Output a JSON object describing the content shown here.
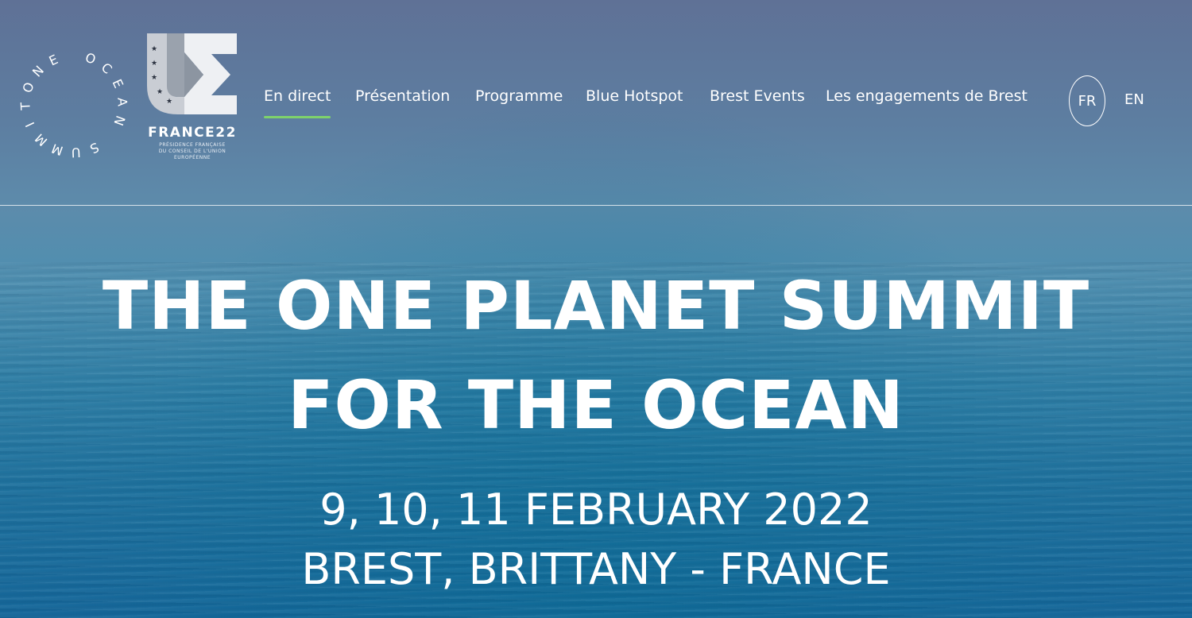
{
  "header": {
    "logo_ocean": {
      "letters": [
        "O",
        "N",
        "E",
        " ",
        "O",
        "C",
        "E",
        "A",
        "N",
        " ",
        "S",
        "U",
        "M",
        "M",
        "I",
        "T"
      ]
    },
    "logo_ue": {
      "title": "FRANCE22",
      "subtitle_line1": "PRÉSIDENCE FRANÇAISE",
      "subtitle_line2": "DU CONSEIL DE L'UNION",
      "subtitle_line3": "EUROPÉENNE"
    },
    "nav": [
      {
        "label": "En direct",
        "active": true
      },
      {
        "label": "Présentation"
      },
      {
        "label": "Programme"
      },
      {
        "label": "Blue Hotspot"
      },
      {
        "label": "Brest Events"
      },
      {
        "label": "Les engagements de Brest"
      }
    ],
    "lang": {
      "fr": "FR",
      "en": "EN",
      "selected": "FR"
    }
  },
  "hero": {
    "title_line1": "THE ONE PLANET SUMMIT",
    "title_line2": "FOR THE OCEAN",
    "dates": "9, 10, 11 FEBRUARY 2022",
    "location": "BREST, BRITTANY - FRANCE"
  },
  "colors": {
    "active_underline": "#7ed36b",
    "sky_top": "#5f7196",
    "ocean_bottom": "#15679a"
  }
}
